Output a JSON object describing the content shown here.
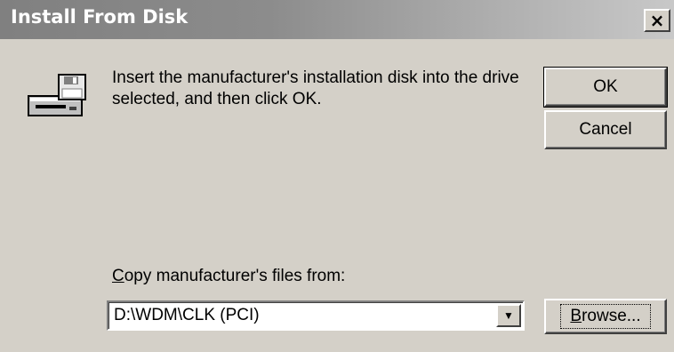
{
  "window": {
    "title": "Install From Disk",
    "close_glyph": "×"
  },
  "icon": {
    "name": "disk-drive-icon"
  },
  "message": "Insert the manufacturer's installation disk into the drive selected, and then click OK.",
  "buttons": {
    "ok": "OK",
    "cancel": "Cancel",
    "browse_mnemonic": "B",
    "browse_rest": "rowse..."
  },
  "copy_from": {
    "label_mnemonic": "C",
    "label_rest": "opy manufacturer's files from:",
    "value": "D:\\WDM\\CLK (PCI)",
    "dropdown_glyph": "▼"
  }
}
